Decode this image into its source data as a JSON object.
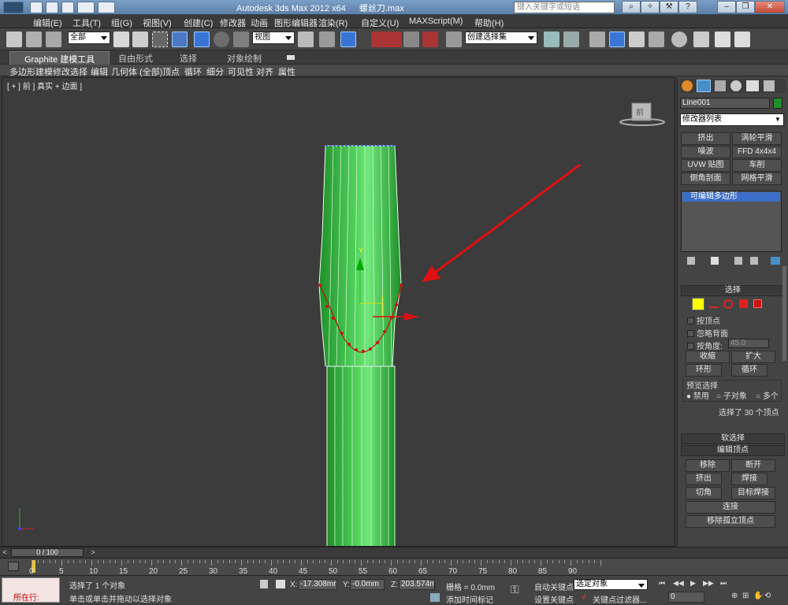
{
  "window": {
    "app_title": "Autodesk 3ds Max  2012 x64",
    "file_name": "螺丝刀.max",
    "search_placeholder": "键入关键字或短语"
  },
  "menu": [
    "编辑(E)",
    "工具(T)",
    "组(G)",
    "视图(V)",
    "创建(C)",
    "修改器",
    "动画",
    "图形编辑器",
    "渲染(R)",
    "自定义(U)",
    "MAXScript(M)",
    "帮助(H)"
  ],
  "toolbar": {
    "selection_filter": "全部",
    "reference_coord": "视图",
    "snap_3": "3",
    "named_selection": "创建选择集"
  },
  "ribbon": {
    "tabs": [
      "Graphite 建模工具",
      "自由形式",
      "选择",
      "对象绘制"
    ],
    "subtabs": [
      "多边形建模",
      "修改选择",
      "编辑",
      "几何体 (全部)",
      "顶点",
      "循环",
      "细分",
      "可见性",
      "对齐",
      "属性"
    ]
  },
  "viewport": {
    "label": "[ + ] 前 ] 真实 + 边面 ]",
    "viewcube_label": "前"
  },
  "command_panel": {
    "object_name": "Line001",
    "object_color": "#1f8f2a",
    "modifier_list": "修改器列表",
    "modifier_buttons": [
      "挤出",
      "涡轮平滑",
      "噪波",
      "FFD 4x4x4",
      "UVW 贴图",
      "车削",
      "倒角剖面",
      "网格平滑"
    ],
    "stack_item": "可编辑多边形",
    "selection": {
      "title": "选择",
      "by_vertex": "按顶点",
      "ignore_backfacing": "忽略背面",
      "by_angle": "按角度:",
      "angle_value": "45.0",
      "shrink": "收缩",
      "grow": "扩大",
      "ring": "环形",
      "loop": "循环",
      "preview_title": "预览选择",
      "preview_off": "禁用",
      "preview_subobj": "子对象",
      "preview_multi": "多个",
      "status": "选择了 30 个顶点"
    },
    "soft_selection": "软选择",
    "edit_vertices": {
      "title": "编辑顶点",
      "remove": "移除",
      "break": "断开",
      "extrude": "挤出",
      "weld": "焊接",
      "chamfer": "切角",
      "target_weld": "目标焊接",
      "connect": "连接",
      "remove_isolated": "移除孤立顶点"
    }
  },
  "timeline": {
    "frame_display": "0 / 100",
    "ticks": [
      "0",
      "5",
      "10",
      "15",
      "20",
      "25",
      "30",
      "35",
      "40",
      "45",
      "50",
      "55",
      "60",
      "65",
      "70",
      "75",
      "80",
      "85",
      "90"
    ]
  },
  "status": {
    "running_label": "所在行:",
    "message1": "选择了 1 个对象",
    "message2": "单击或单击并拖动以选择对象",
    "x_label": "X:",
    "x_value": "-17.308mm",
    "y_label": "Y:",
    "y_value": "-0.0mm",
    "z_label": "Z:",
    "z_value": "203.574mm",
    "grid": "栅格 = 0.0mm",
    "add_time_tag": "添加时间标记",
    "auto_key": "自动关键点",
    "set_key": "设置关键点",
    "selected_object": "选定对象",
    "key_filters": "关键点过滤器...",
    "frame_value": "0"
  },
  "colors": {
    "object_green": "#2fb83a",
    "arrow_red": "#e01010",
    "vertex_red": "#cc1111"
  }
}
